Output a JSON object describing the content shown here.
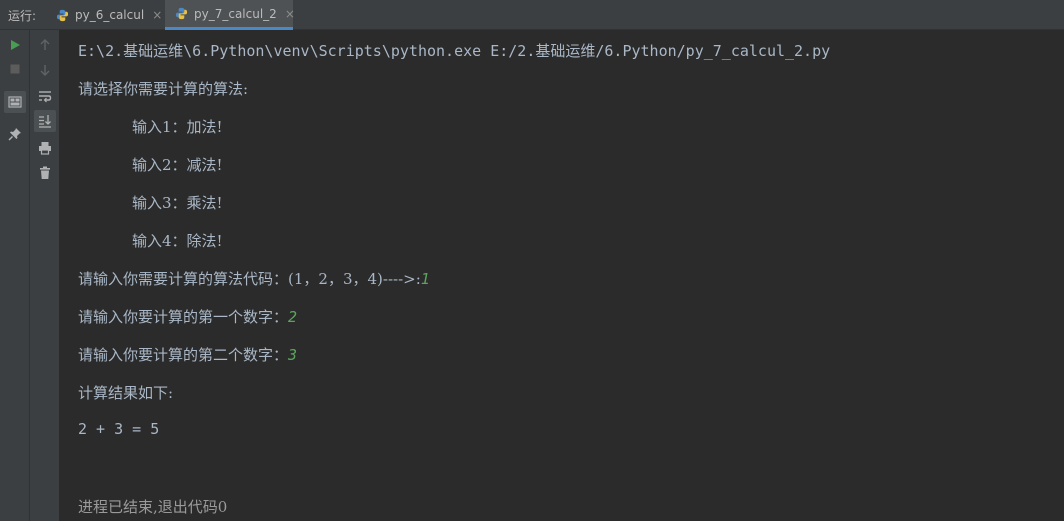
{
  "tabbar": {
    "run_label": "运行:",
    "tabs": [
      {
        "label": "py_6_calcul",
        "close": "×"
      },
      {
        "label": "py_7_calcul_2",
        "close": "×"
      }
    ]
  },
  "console": {
    "command": "E:\\2.基础运维\\6.Python\\venv\\Scripts\\python.exe E:/2.基础运维/6.Python/py_7_calcul_2.py",
    "prompt_choose": "请选择你需要计算的算法:",
    "options": [
      "输入1：加法!",
      "输入2：减法!",
      "输入3：乘法!",
      "输入4：除法!"
    ],
    "prompt_code": "请输入你需要计算的算法代码：(1，2，3，4)---->:",
    "input_code": "1",
    "prompt_first": "请输入你要计算的第一个数字：",
    "input_first": "2",
    "prompt_second": "请输入你要计算的第二个数字：",
    "input_second": "3",
    "result_header": "计算结果如下:",
    "result": "2 + 3 = 5",
    "exit_message": "进程已结束,退出代码0"
  },
  "colors": {
    "background": "#2b2b2b",
    "toolbar": "#3c3f41",
    "text": "#a9b7c6",
    "user_input": "#5aa55a",
    "run_green": "#499c54",
    "tab_underline": "#4a88c7"
  },
  "icons": {
    "toolbar_left": [
      "run-icon",
      "stop-icon",
      "layout-icon",
      "pin-icon"
    ],
    "toolbar_right": [
      "scroll-up-icon",
      "scroll-down-icon",
      "soft-wrap-icon",
      "scroll-to-end-icon",
      "print-icon",
      "trash-icon"
    ]
  }
}
